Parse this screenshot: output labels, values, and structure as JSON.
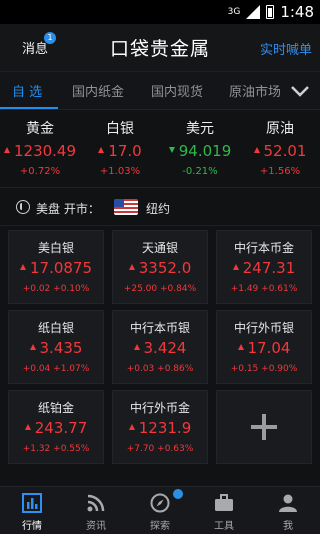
{
  "status": {
    "signal": "3G",
    "time": "1:48"
  },
  "header": {
    "left_label": "消息",
    "badge": "1",
    "title": "口袋贵金属",
    "right_label": "实时喊单"
  },
  "tabs": [
    {
      "label": "自 选"
    },
    {
      "label": "国内纸金"
    },
    {
      "label": "国内现货"
    },
    {
      "label": "原油市场"
    }
  ],
  "quotes": [
    {
      "name": "黄金",
      "value": "1230.49",
      "change": "+0.72%",
      "direction": "up"
    },
    {
      "name": "白银",
      "value": "17.0",
      "change": "+1.03%",
      "direction": "up"
    },
    {
      "name": "美元",
      "value": "94.019",
      "change": "-0.21%",
      "direction": "down"
    },
    {
      "name": "原油",
      "value": "52.01",
      "change": "+1.56%",
      "direction": "up"
    }
  ],
  "market": {
    "label": "美盘 开市：",
    "city": "纽约"
  },
  "grid": [
    {
      "name": "美白银",
      "price": "17.0875",
      "change": "+0.02",
      "pct": "+0.10%"
    },
    {
      "name": "天通银",
      "price": "3352.0",
      "change": "+25.00",
      "pct": "+0.84%"
    },
    {
      "name": "中行本币金",
      "price": "247.31",
      "change": "+1.49",
      "pct": "+0.61%"
    },
    {
      "name": "纸白银",
      "price": "3.435",
      "change": "+0.04",
      "pct": "+1.07%"
    },
    {
      "name": "中行本币银",
      "price": "3.424",
      "change": "+0.03",
      "pct": "+0.86%"
    },
    {
      "name": "中行外币银",
      "price": "17.04",
      "change": "+0.15",
      "pct": "+0.90%"
    },
    {
      "name": "纸铂金",
      "price": "243.77",
      "change": "+1.32",
      "pct": "+0.55%"
    },
    {
      "name": "中行外币金",
      "price": "1231.9",
      "change": "+7.70",
      "pct": "+0.63%"
    }
  ],
  "bottom_nav": [
    {
      "label": "行情",
      "icon": "chart-icon"
    },
    {
      "label": "资讯",
      "icon": "rss-icon"
    },
    {
      "label": "探索",
      "icon": "compass-icon"
    },
    {
      "label": "工具",
      "icon": "briefcase-icon"
    },
    {
      "label": "我",
      "icon": "person-icon"
    }
  ],
  "colors": {
    "accent": "#1f8ff0",
    "up": "#f2383a",
    "down": "#2fb84c",
    "background": "#111214"
  }
}
